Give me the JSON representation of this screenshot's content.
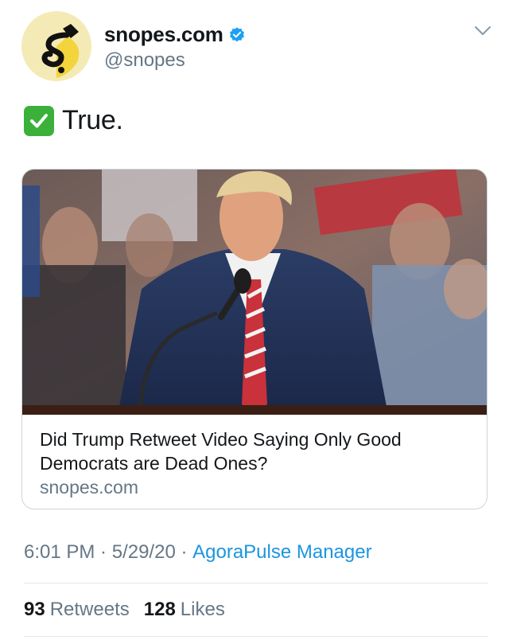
{
  "author": {
    "display_name": "snopes.com",
    "handle": "@snopes",
    "verified": true
  },
  "tweet": {
    "text": "True.",
    "emoji": "white-heavy-check-mark"
  },
  "card": {
    "title": "Did Trump Retweet Video Saying Only Good Democrats are Dead Ones?",
    "domain": "snopes.com"
  },
  "meta": {
    "time": "6:01 PM",
    "sep1": " · ",
    "date": "5/29/20",
    "sep2": " · ",
    "source": "AgoraPulse Manager"
  },
  "stats": {
    "retweets_count": "93",
    "retweets_label": "Retweets",
    "likes_count": "128",
    "likes_label": "Likes"
  },
  "colors": {
    "link_blue": "#1b95e0",
    "verified_blue": "#1da1f2",
    "check_green": "#3bb13b",
    "muted_gray": "#657786"
  }
}
